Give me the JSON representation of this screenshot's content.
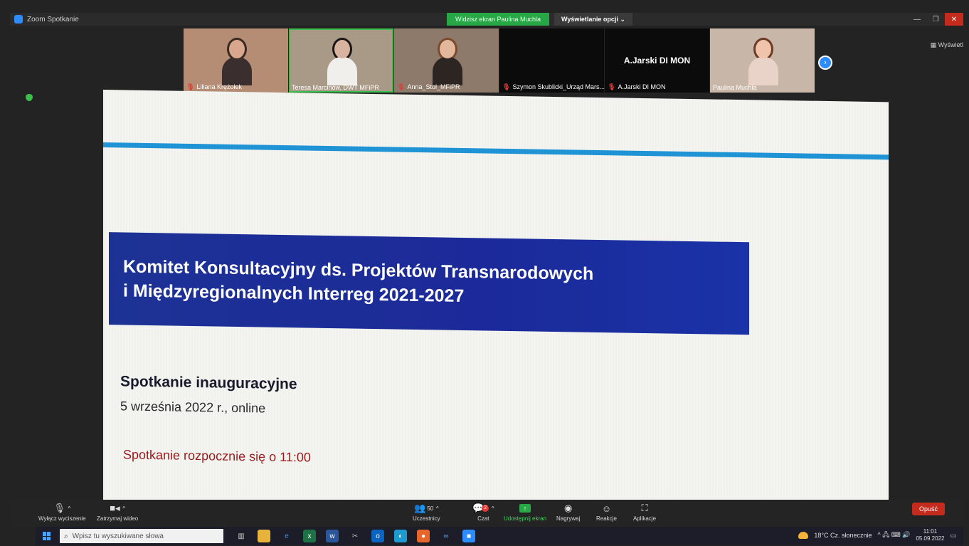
{
  "window": {
    "title": "Zoom Spotkanie",
    "share_banner": "Widzisz ekran Paulina Muchla",
    "view_options": "Wyświetlanie opcji ⌄",
    "view_button": "Wyświetl",
    "min": "—",
    "max": "❐",
    "close": "✕"
  },
  "participants": [
    {
      "name": "Liliana Krężołek",
      "muted": true,
      "video": true,
      "bg": "#b58c74",
      "skin": "#d9a78d",
      "shirt": "#3a2e2e",
      "hair": "#3b2a22"
    },
    {
      "name": "Teresa Marcinów, DWT MFiPR",
      "muted": false,
      "video": true,
      "bg": "#a99987",
      "skin": "#d8b3a0",
      "shirt": "#f0efeb",
      "hair": "#1b1616",
      "active": true
    },
    {
      "name": "Anna_Stol_MFiPR",
      "muted": true,
      "video": true,
      "bg": "#8e7a6a",
      "skin": "#e2b79c",
      "shirt": "#2c2522",
      "hair": "#7a4a2e"
    },
    {
      "name": "Szymon Skublicki_Urząd Mars...",
      "muted": true,
      "video": false
    },
    {
      "name": "A.Jarski DI MON",
      "muted": true,
      "video": false,
      "center_label": "A.Jarski DI MON"
    },
    {
      "name": "Paulina Muchla",
      "muted": false,
      "video": true,
      "bg": "#c8b6a8",
      "skin": "#f0c4aa",
      "shirt": "#e9d3c8",
      "hair": "#6b3a24"
    }
  ],
  "next_arrow": "›",
  "slide": {
    "title_line1": "Komitet Konsultacyjny ds. Projektów Transnarodowych",
    "title_line2": "i Międzyregionalnych Interreg 2021-2027",
    "subtitle": "Spotkanie inauguracyjne",
    "date": "5 września 2022 r., online",
    "start_note": "Spotkanie rozpocznie się o 11:00"
  },
  "toolbar": {
    "mute_label": "Wyłącz wyciszenie",
    "video_label": "Zatrzymaj wideo",
    "participants_label": "Uczestnicy",
    "participants_count": "50",
    "chat_label": "Czat",
    "chat_badge": "2",
    "share_label": "Udostępnij ekran",
    "record_label": "Nagrywaj",
    "reactions_label": "Reakcje",
    "apps_label": "Aplikacje",
    "leave_label": "Opuść",
    "caret": "^"
  },
  "taskbar": {
    "search_placeholder": "Wpisz tu wyszukiwane słowa",
    "weather": "18°C  Cz. słonecznie",
    "time": "11:01",
    "date": "05.09.2022",
    "tray_icons": "^ 🖧 ⌨ 🔊"
  },
  "colors": {
    "accent_green": "#27a745",
    "zoom_blue": "#2d8cff",
    "slide_banner": "#1d3296",
    "slide_rule": "#1f94d6",
    "leave_red": "#c42b1c"
  }
}
